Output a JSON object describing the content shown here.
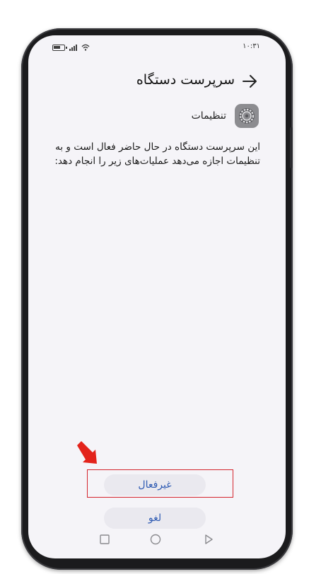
{
  "status_bar": {
    "time": "۱۰:۳۱"
  },
  "header": {
    "title": "سرپرست دستگاه"
  },
  "app": {
    "name": "تنظیمات"
  },
  "description": "این سرپرست دستگاه در حال حاضر فعال است و به تنظیمات اجازه می‌دهد عملیات‌های زیر را انجام دهد:",
  "buttons": {
    "deactivate_label": "غیرفعال",
    "cancel_label": "لغو"
  },
  "colors": {
    "accent": "#2f5bb3",
    "highlight": "#d4252e",
    "screen_bg": "#f5f4f8",
    "button_bg": "#eae9ef"
  },
  "icons": [
    "battery-icon",
    "signal-icon",
    "wifi-icon",
    "back-arrow-icon",
    "settings-gear-icon",
    "nav-recent-icon",
    "nav-home-icon",
    "nav-back-icon",
    "pointer-arrow-icon"
  ]
}
